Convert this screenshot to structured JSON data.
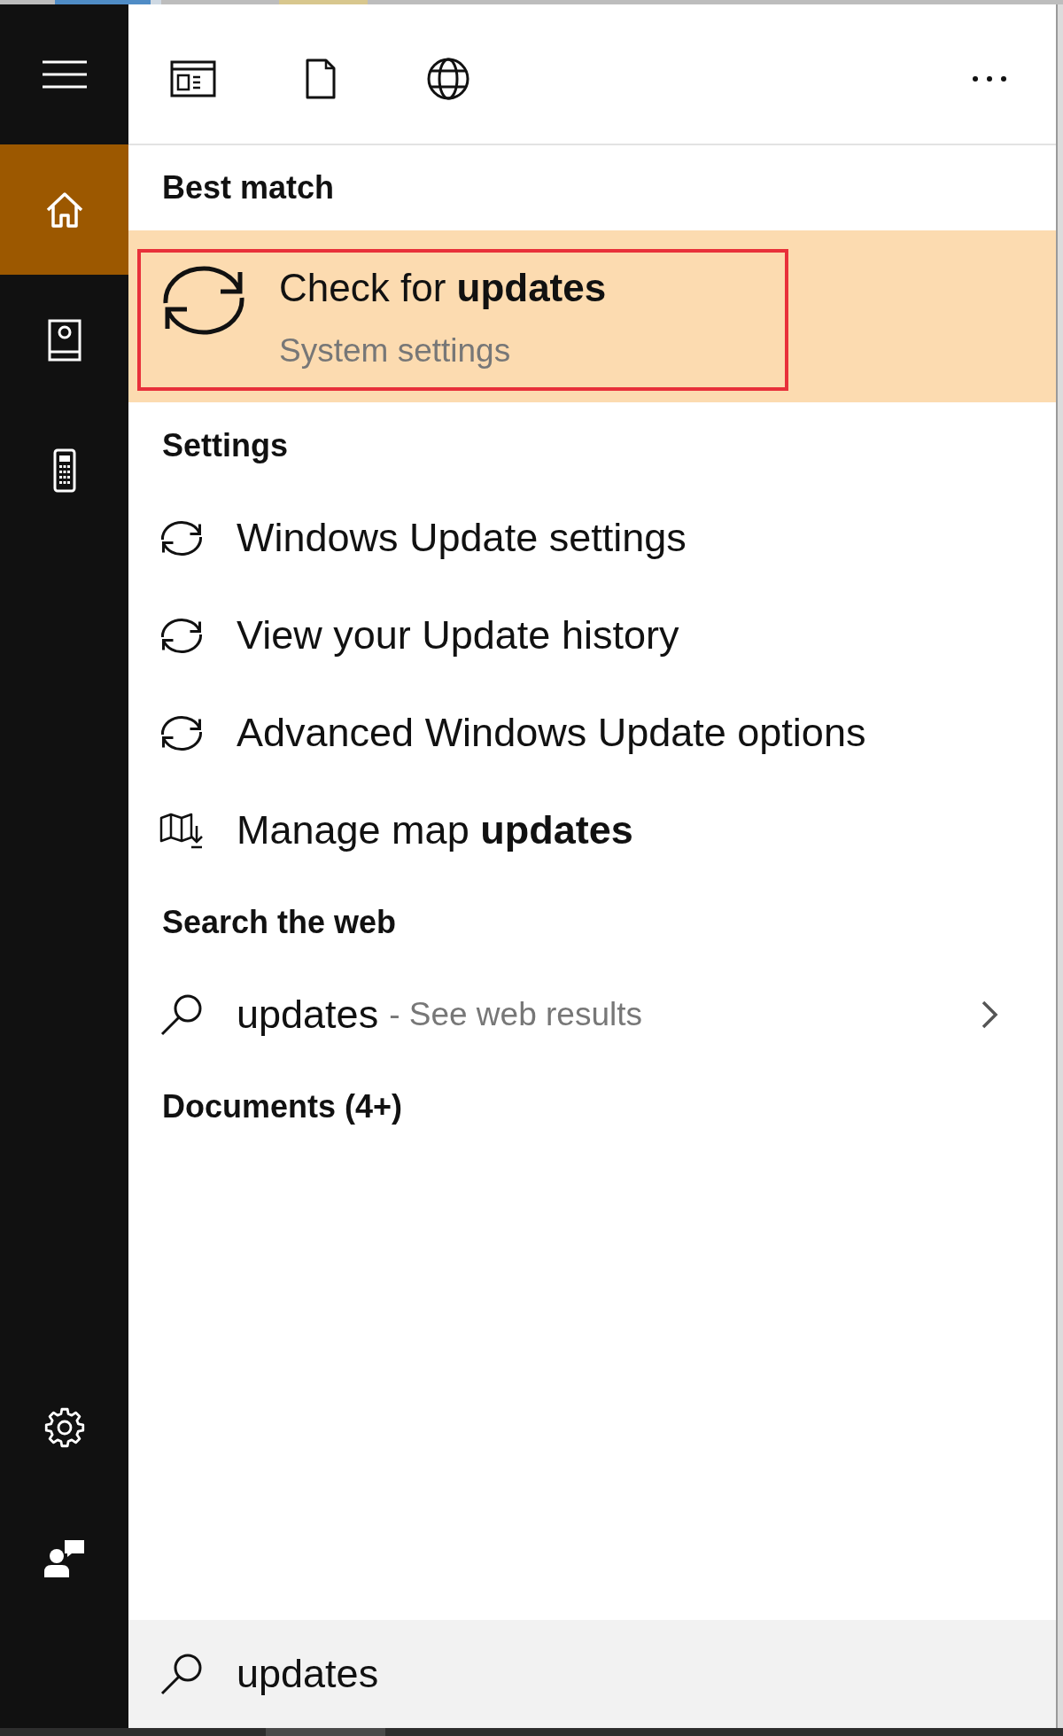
{
  "sidebar": {
    "items": [
      {
        "selected": true
      },
      {
        "selected": false
      },
      {
        "selected": false
      }
    ]
  },
  "results": {
    "sections": [
      {
        "heading": "Best match",
        "items": [
          {
            "kind": "app",
            "title": "Check for **updates**",
            "subtitle": "System settings",
            "selected": true,
            "outlined": true
          }
        ]
      },
      {
        "heading": "Settings",
        "items": [
          {
            "kind": "update",
            "title": "Windows Update settings",
            "selected": false,
            "outlined": false
          },
          {
            "kind": "update",
            "title": "View your Update history",
            "selected": false,
            "outlined": false
          },
          {
            "kind": "update",
            "title": "Advanced Windows Update options",
            "selected": false,
            "outlined": false
          },
          {
            "kind": "map",
            "title": "Manage map **updates**",
            "selected": false,
            "outlined": false
          }
        ]
      },
      {
        "heading": "Search the web",
        "items": [
          {
            "kind": "web",
            "title": "updates",
            "hint": "- See web results",
            "selected": false,
            "outlined": false
          }
        ]
      },
      {
        "heading": "Documents (4+)"
      }
    ]
  },
  "search_box": {
    "value": "updates"
  }
}
